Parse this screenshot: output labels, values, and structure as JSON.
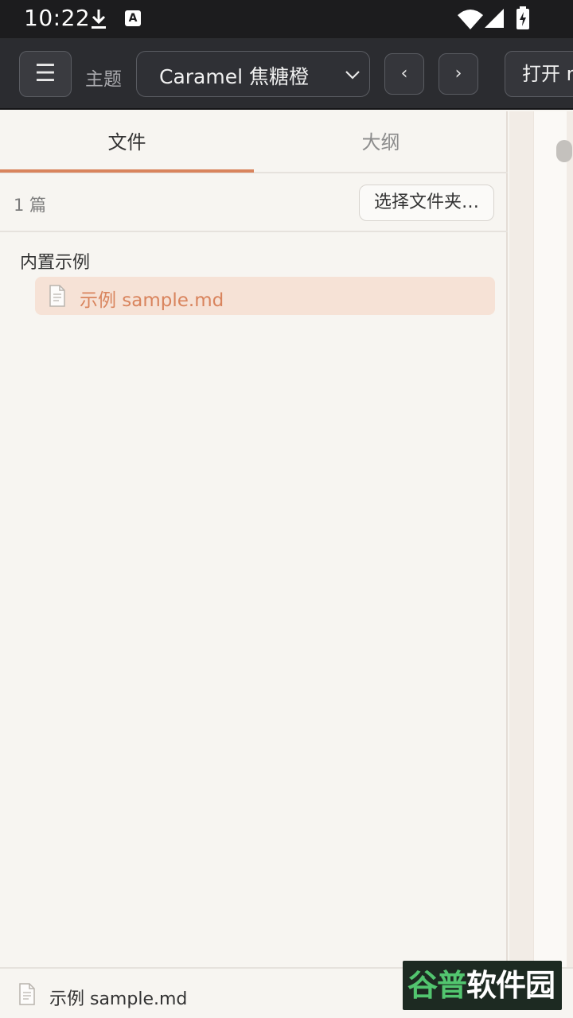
{
  "status_bar": {
    "time": "10:22",
    "icons": [
      "download-icon",
      "accessibility-a-icon",
      "wifi-icon",
      "signal-icon",
      "battery-charging-icon"
    ]
  },
  "toolbar": {
    "menu_icon": "☰",
    "theme_label": "主题",
    "theme_value": "Caramel 焦糖橙",
    "prev_label": "‹",
    "next_label": "›",
    "open_label": "打开 md"
  },
  "sidebar": {
    "tabs": [
      {
        "label": "文件",
        "active": true
      },
      {
        "label": "大纲",
        "active": false
      }
    ],
    "file_count": "1 篇",
    "choose_folder_label": "选择文件夹…",
    "groups": [
      {
        "title": "内置示例",
        "items": [
          {
            "label": "示例 sample.md",
            "selected": true
          }
        ]
      }
    ]
  },
  "footer": {
    "current_file": "示例 sample.md"
  },
  "watermark": {
    "part1": "谷普",
    "part2": "软件园"
  },
  "colors": {
    "accent": "#d9845d",
    "selected_bg": "#f6e2d6",
    "toolbar_bg": "#2b2c30",
    "statusbar_bg": "#1c1c1e",
    "sidebar_bg": "#f7f5f1"
  }
}
